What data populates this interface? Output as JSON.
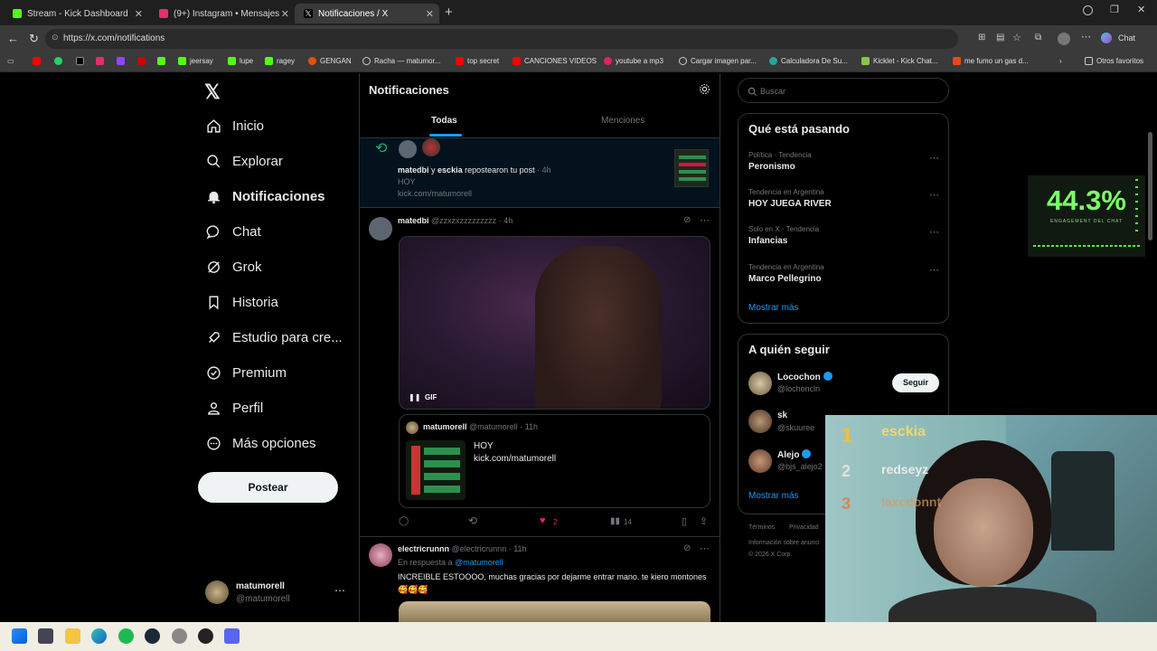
{
  "tabs": [
    {
      "title": "Stream - Kick Dashboard"
    },
    {
      "title": "(9+) Instagram • Mensajes"
    },
    {
      "title": "Notificaciones / X"
    }
  ],
  "browser": {
    "url": "https://x.com/notifications",
    "chat_label": "Chat"
  },
  "bookmarks": [
    "jeersay",
    "lupe",
    "ragey",
    "GENGAN",
    "Racha — matumor...",
    "top secret",
    "CANCIONES VIDEOS",
    "youtube a mp3",
    "Cargar imagen par...",
    "Calculadora De Su...",
    "Kicklet - Kick Chat...",
    "me fumo un gas d...",
    "Otros favoritos"
  ],
  "nav": {
    "items": [
      "Inicio",
      "Explorar",
      "Notificaciones",
      "Chat",
      "Grok",
      "Historia",
      "Estudio para cre...",
      "Premium",
      "Perfil",
      "Más opciones"
    ],
    "post_label": "Postear",
    "account_name": "matumorell",
    "account_handle": "@matumorell"
  },
  "notifications": {
    "title": "Notificaciones",
    "tab_all": "Todas",
    "tab_mentions": "Menciones",
    "repost": {
      "name1": "matedbi",
      "and": "y",
      "name2": "esckia",
      "action": "repostearon tu post",
      "time": "· 4h",
      "line1": "HOY",
      "line2": "kick.com/matumorell"
    },
    "post": {
      "name": "matedbi",
      "handle": "@zzxzxzzzzzzzzz",
      "time": "· 4h",
      "gif_label": "GIF",
      "quote": {
        "name": "matumorell",
        "handle": "@matumorell",
        "time": "· 11h",
        "line1": "HOY",
        "line2": "kick.com/matumorell"
      },
      "likes": "2",
      "views": "14"
    },
    "reply": {
      "name": "electricrunnn",
      "handle": "@electricrunnn",
      "time": "· 11h",
      "in_reply": "En respuesta a",
      "to": "@matumorell",
      "text": "INCREIBLE ESTOOOO, muchas gracias por dejarme entrar mano. te kiero montones 🥰🥰🥰"
    }
  },
  "right": {
    "search_placeholder": "Buscar",
    "trends_title": "Qué está pasando",
    "trends": [
      {
        "category": "Política · Tendencia",
        "name": "Peronismo"
      },
      {
        "category": "Tendencia en Argentina",
        "name": "HOY JUEGA RIVER"
      },
      {
        "category": "Solo en X · Tendencia",
        "name": "Infancias"
      },
      {
        "category": "Tendencia en Argentina",
        "name": "Marco Pellegrino"
      }
    ],
    "show_more": "Mostrar más",
    "follow_title": "A quién seguir",
    "follow": [
      {
        "name": "Locochon",
        "handle": "@lochoncln",
        "button": "Seguir"
      },
      {
        "name": "sk",
        "handle": "@skuuree"
      },
      {
        "name": "Alejo",
        "handle": "@bjs_alejo2"
      }
    ],
    "follow_more": "Mostrar más",
    "footer1": "Términos",
    "footer2": "Privacidad",
    "footer3": "Información sobre anunci",
    "footer4": "© 2026 X Corp."
  },
  "overlay": {
    "engagement_value": "44.3%",
    "engagement_label": "ENGAGEMENT DEL CHAT",
    "leaderboard": [
      {
        "rank": "1",
        "name": "esckia"
      },
      {
        "rank": "2",
        "name": "redseyz"
      },
      {
        "rank": "3",
        "name": "laxcdonnt"
      }
    ]
  }
}
